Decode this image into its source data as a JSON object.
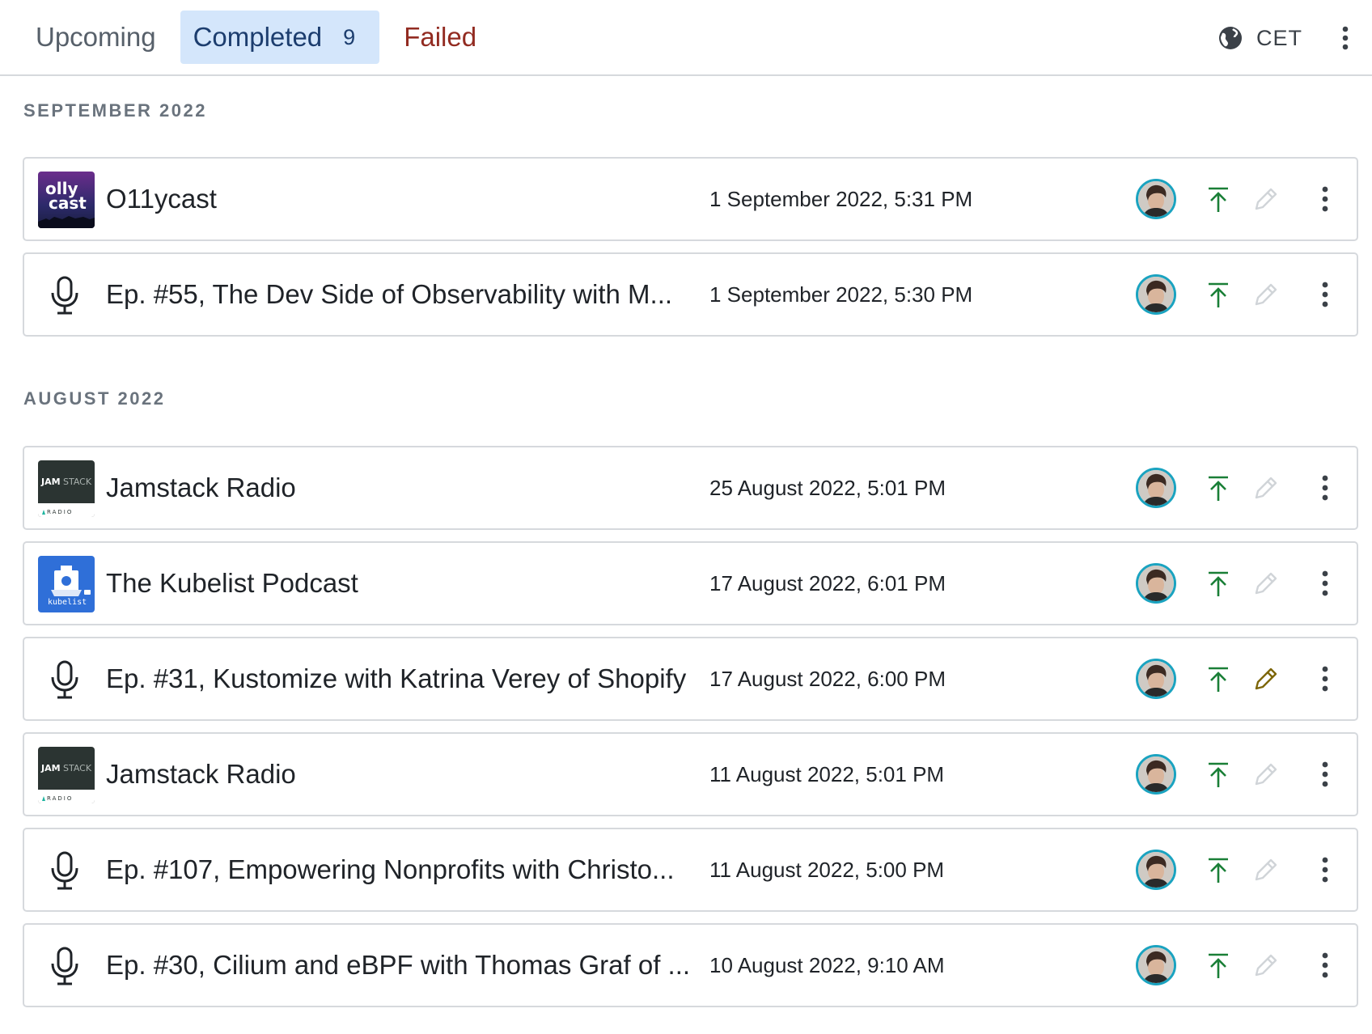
{
  "tabs": {
    "upcoming": "Upcoming",
    "completed": "Completed",
    "completed_count": "9",
    "failed": "Failed"
  },
  "timezone": "CET",
  "sections": [
    {
      "heading": "SEPTEMBER 2022",
      "items": [
        {
          "thumb": "ollycast-logo",
          "title": "O11ycast",
          "date": "1 September 2022, 5:31 PM",
          "edit_active": false
        },
        {
          "thumb": "microphone-icon",
          "title": "Ep. #55, The Dev Side of Observability with M...",
          "date": "1 September 2022, 5:30 PM",
          "edit_active": false
        }
      ]
    },
    {
      "heading": "AUGUST 2022",
      "items": [
        {
          "thumb": "jamstack-logo",
          "title": "Jamstack Radio",
          "date": "25 August 2022, 5:01 PM",
          "edit_active": false
        },
        {
          "thumb": "kubelist-logo",
          "title": "The Kubelist Podcast",
          "date": "17 August 2022, 6:01 PM",
          "edit_active": false
        },
        {
          "thumb": "microphone-icon",
          "title": "Ep. #31, Kustomize with Katrina Verey of Shopify",
          "date": "17 August 2022, 6:00 PM",
          "edit_active": true
        },
        {
          "thumb": "jamstack-logo",
          "title": "Jamstack Radio",
          "date": "11 August 2022, 5:01 PM",
          "edit_active": false
        },
        {
          "thumb": "microphone-icon",
          "title": "Ep. #107, Empowering Nonprofits with Christo...",
          "date": "11 August 2022, 5:00 PM",
          "edit_active": false
        },
        {
          "thumb": "microphone-icon",
          "title": "Ep. #30, Cilium and eBPF with Thomas Graf of ...",
          "date": "10 August 2022, 9:10 AM",
          "edit_active": false
        }
      ]
    }
  ],
  "logos": {
    "ollycast": [
      "olly",
      "cast"
    ],
    "jamstack": [
      "JAM",
      "STACK",
      "RADIO"
    ],
    "kubelist": "kubelist"
  },
  "colors": {
    "completed_tab_bg": "#d4e6fb",
    "failed_text": "#922b21",
    "publish_green": "#1a7f37",
    "edit_inactive": "#d0d4d8",
    "edit_active": "#7d6608",
    "avatar_ring": "#1aa3c0"
  }
}
